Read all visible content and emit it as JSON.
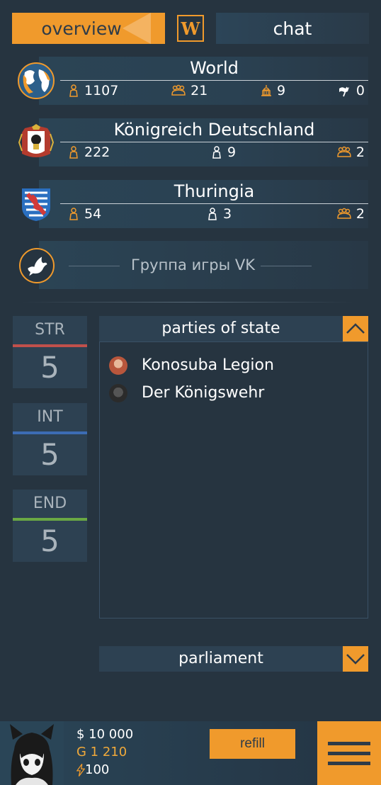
{
  "tabs": {
    "overview": "overview",
    "wiki": "W",
    "chat": "chat"
  },
  "regions": [
    {
      "name": "World",
      "stats": [
        {
          "icon": "residents-icon",
          "value": "1107"
        },
        {
          "icon": "group-icon",
          "value": "21"
        },
        {
          "icon": "capitol-icon",
          "value": "9"
        },
        {
          "icon": "war-flag-icon",
          "value": "0"
        }
      ]
    },
    {
      "name": "Königreich Deutschland",
      "stats": [
        {
          "icon": "residents-icon",
          "value": "222"
        },
        {
          "icon": "citizen-icon",
          "value": "9"
        },
        {
          "icon": "group-icon",
          "value": "2"
        }
      ]
    },
    {
      "name": "Thuringia",
      "stats": [
        {
          "icon": "residents-icon",
          "value": "54"
        },
        {
          "icon": "citizen-icon",
          "value": "3"
        },
        {
          "icon": "group-icon",
          "value": "2"
        }
      ]
    }
  ],
  "vk": {
    "label": "Группа игры VK"
  },
  "attributes": [
    {
      "name": "STR",
      "value": "5",
      "color": "#c0504b"
    },
    {
      "name": "INT",
      "value": "5",
      "color": "#3c6cb4"
    },
    {
      "name": "END",
      "value": "5",
      "color": "#6aa844"
    }
  ],
  "parties": {
    "title": "parties of state",
    "items": [
      {
        "name": "Konosuba Legion",
        "color": "#b8563c"
      },
      {
        "name": "Der Königswehr",
        "color": "#2b2b2b"
      }
    ]
  },
  "parliament": {
    "title": "parliament"
  },
  "footer": {
    "cash": "$ 10 000",
    "gold": "G 1 210",
    "energy": "100",
    "refill": "refill"
  },
  "colors": {
    "accent": "#f09a2c",
    "background": "#263440",
    "panel": "#2d4152"
  }
}
